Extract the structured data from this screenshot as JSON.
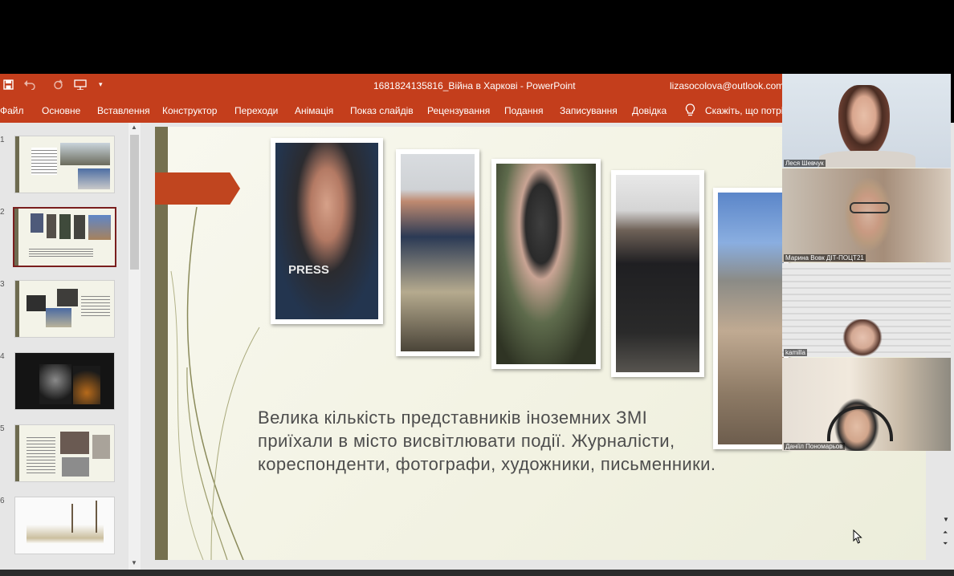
{
  "app": {
    "doc_title": "1681824135816_Війна в Харкові  -  PowerPoint",
    "account": "lizasocolova@outlook.com",
    "qat_icons": [
      "save-icon",
      "undo-icon",
      "redo-icon",
      "present-icon",
      "customize-icon"
    ]
  },
  "ribbon": {
    "tabs": [
      "Файл",
      "Основне",
      "Вставлення",
      "Конструктор",
      "Переходи",
      "Анімація",
      "Показ слайдів",
      "Рецензування",
      "Подання",
      "Записування",
      "Довідка"
    ],
    "tell_me": "Скажіть, що потрібно зробити"
  },
  "thumbnails": {
    "numbers": [
      "1",
      "2",
      "3",
      "4",
      "5",
      "6"
    ],
    "selected": 2
  },
  "slide": {
    "text": "Велика кількість представників іноземних ЗМІ приїхали в місто висвітлювати події. Журналісти, кореспонденти, фотографи, художники, письменники."
  },
  "participants": [
    {
      "name": "Леся Шевчук"
    },
    {
      "name": "Марина Вовк ДІТ-ПОЦТ21"
    },
    {
      "name": "kamilla"
    },
    {
      "name": "Даніїл Пономарьов"
    }
  ],
  "colors": {
    "ribbon": "#c43e1c",
    "slide_accent": "#c0451f",
    "slide_bar": "#75704f",
    "selected_thumb_border": "#7a1e1e"
  }
}
